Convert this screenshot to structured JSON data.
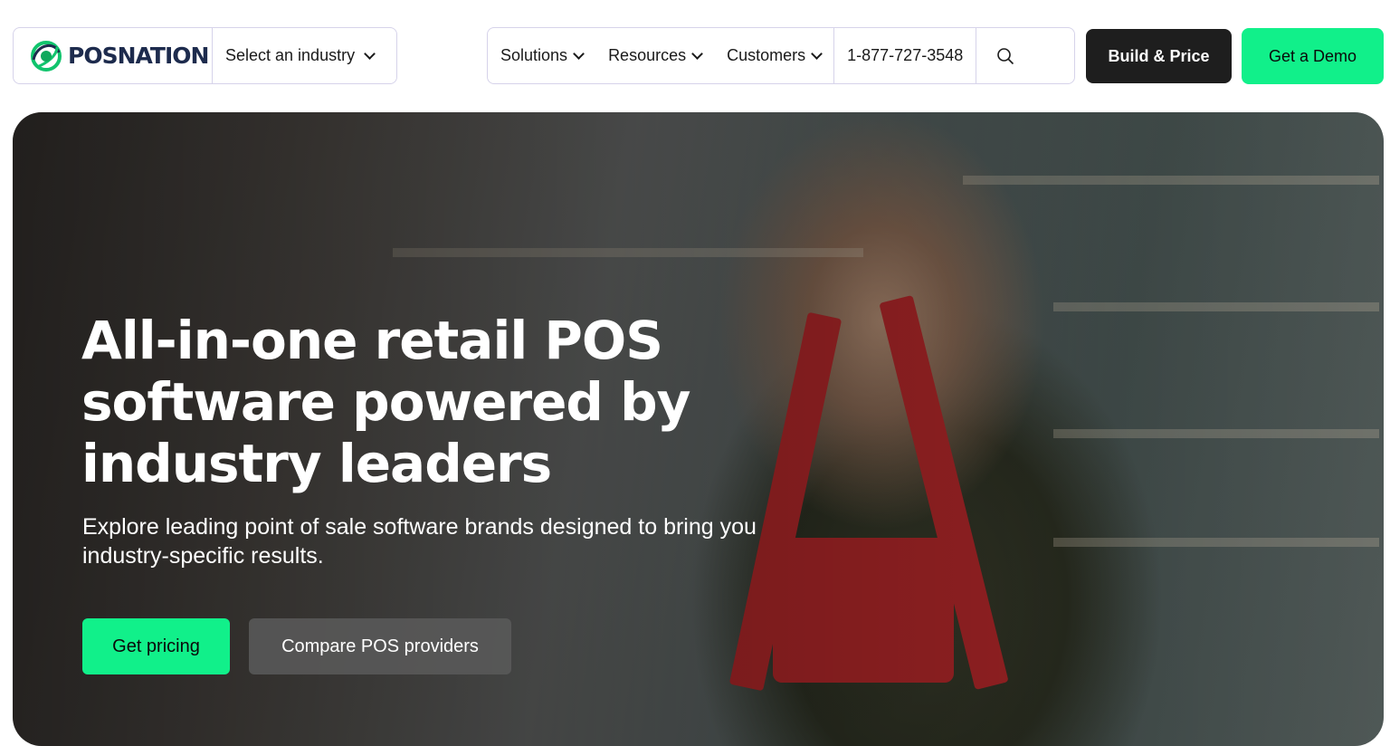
{
  "brand": {
    "name": "POSNATION",
    "accent": "#11f08a",
    "dark": "#1e1e1e"
  },
  "nav": {
    "industry_select": "Select an industry",
    "menu": [
      {
        "label": "Solutions"
      },
      {
        "label": "Resources"
      },
      {
        "label": "Customers"
      }
    ],
    "phone": "1-877-727-3548",
    "search_icon": "search-icon",
    "build_price": "Build & Price",
    "get_demo": "Get a Demo"
  },
  "hero": {
    "title": "All-in-one retail POS software powered by industry leaders",
    "subtitle": "Explore leading point of sale software brands designed to bring you industry-specific results.",
    "primary_cta": "Get pricing",
    "secondary_cta": "Compare POS providers"
  }
}
